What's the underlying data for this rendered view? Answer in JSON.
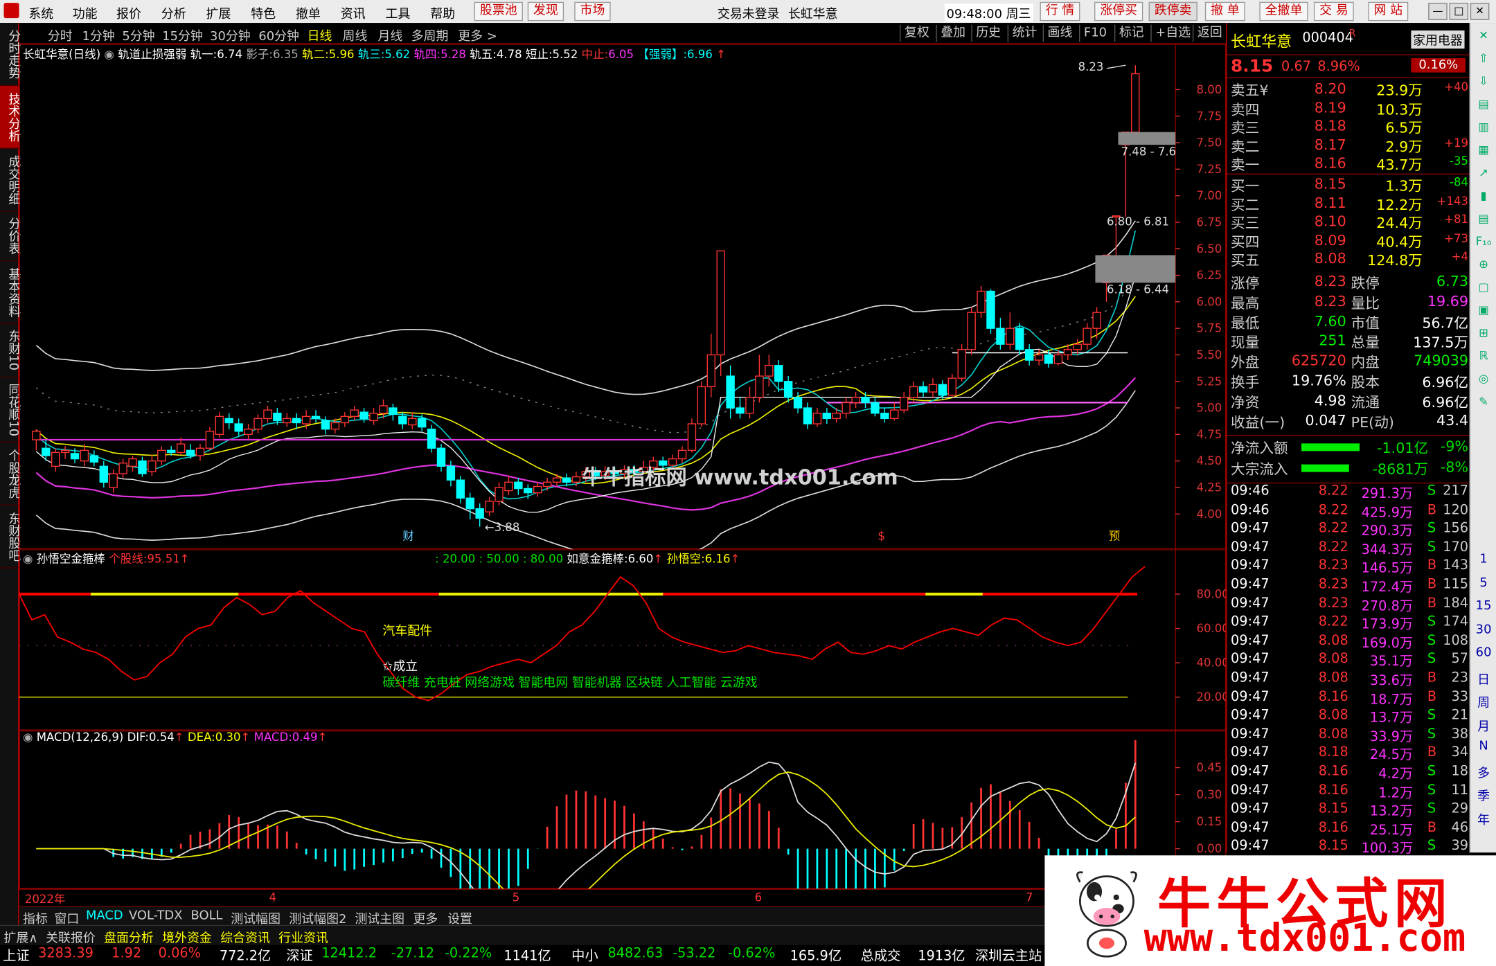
{
  "menu": {
    "items": [
      "系统",
      "功能",
      "报价",
      "分析",
      "扩展",
      "特色",
      "撤单",
      "资讯",
      "工具",
      "帮助"
    ],
    "tabs": [
      "股票池",
      "发现",
      "市场"
    ],
    "login_status": "交易未登录",
    "stock_name_title": "长虹华意",
    "time": "09:48:00 周三",
    "right_buttons": [
      "行 情",
      "涨停买",
      "跌停卖",
      "撤 单",
      "全撤单",
      "交 易",
      "网 站"
    ]
  },
  "left_tabs": [
    "分时走势",
    "技术分析",
    "成交明细",
    "分价表",
    "基本资料",
    "东财10",
    "同花顺10",
    "个股龙虎",
    "东财股吧"
  ],
  "periods": [
    "分时",
    "1分钟",
    "5分钟",
    "15分钟",
    "30分钟",
    "60分钟",
    "日线",
    "周线",
    "月线",
    "多周期",
    "更多 >"
  ],
  "toolbar": [
    "复权",
    "叠加",
    "历史",
    "统计",
    "画线",
    "F10",
    "标记",
    "+自选",
    "返回"
  ],
  "main_chart": {
    "legend": {
      "name": "长虹华意(日线)",
      "indicator": "轨道止损强弱",
      "t1_label": "轨一:",
      "t1": "6.74",
      "shadow_label": "影子:",
      "shadow": "6.35",
      "t2_label": "轨二:",
      "t2": "5.96",
      "t3_label": "轨三:",
      "t3": "5.62",
      "t4_label": "轨四:",
      "t4": "5.28",
      "t5_label": "轨五:",
      "t5": "4.78",
      "stop_label": "短止:",
      "stop": "5.52",
      "mid_label": "中止:",
      "mid": "6.05",
      "strong_label": "【强弱】:",
      "strong": "6.96"
    },
    "y_ticks": [
      "8.00",
      "7.75",
      "7.50",
      "7.25",
      "7.00",
      "6.75",
      "6.50",
      "6.25",
      "6.00",
      "5.75",
      "5.50",
      "5.25",
      "5.00",
      "4.75",
      "4.50",
      "4.25",
      "4.00"
    ],
    "annotations": {
      "high": "8.23",
      "low": "3.88",
      "range1": "7.48 - 7.6",
      "range2": "6.80 - 6.81",
      "range3": "6.18 - 6.44"
    },
    "markers": [
      "财",
      "$",
      "预"
    ],
    "watermark": "牛牛指标网 www.tdx001.com"
  },
  "sub1": {
    "legend_name": "孙悟空金箍棒",
    "legend_stock_label": "个股线:",
    "legend_stock": "95.51",
    "legend_levels": ": 20.00   : 50.00   : 80.00",
    "legend_ruyi_label": "如意金箍棒:",
    "legend_ruyi": "6.60",
    "legend_swk_label": "孙悟空:",
    "legend_swk": "6.16",
    "y_ticks": [
      "80.00",
      "60.00",
      "40.00",
      "20.00"
    ],
    "text1": "汽车配件",
    "text2": "✩成立",
    "text3": "碳纤维 充电桩 网络游戏 智能电网 智能机器 区块链 人工智能 云游戏"
  },
  "sub2": {
    "legend_name": "MACD(12,26,9)",
    "dif_label": "DIF:",
    "dif": "0.54",
    "dea_label": "DEA:",
    "dea": "0.30",
    "macd_label": "MACD:",
    "macd": "0.49",
    "y_ticks": [
      "0.45",
      "0.30",
      "0.15",
      "0.00"
    ]
  },
  "time_axis": [
    "2022年",
    "4",
    "5",
    "6",
    "7"
  ],
  "bottom_tabs": [
    "指标",
    "窗口",
    "MACD",
    "VOL-TDX",
    "BOLL",
    "测试幅图",
    "测试幅图2",
    "测试主图",
    "更多",
    "设置"
  ],
  "bottom_tabs2": [
    "扩展∧",
    "关联报价",
    "盘面分析",
    "境外资金",
    "综合资讯",
    "行业资讯"
  ],
  "quote": {
    "name": "长虹华意",
    "code": "000404",
    "mark": "R",
    "industry": "家用电器",
    "price": "8.15",
    "change": "0.67",
    "pct": "8.96%",
    "ind_pct": "0.16%",
    "asks": [
      {
        "label": "卖五¥",
        "price": "8.20",
        "vol": "23.9万",
        "chg": "+40"
      },
      {
        "label": "卖四",
        "price": "8.19",
        "vol": "10.3万",
        "chg": ""
      },
      {
        "label": "卖三",
        "price": "8.18",
        "vol": "6.5万",
        "chg": ""
      },
      {
        "label": "卖二",
        "price": "8.17",
        "vol": "2.9万",
        "chg": "+19"
      },
      {
        "label": "卖一",
        "price": "8.16",
        "vol": "43.7万",
        "chg": "-35"
      }
    ],
    "bids": [
      {
        "label": "买一",
        "price": "8.15",
        "vol": "1.3万",
        "chg": "-84"
      },
      {
        "label": "买二",
        "price": "8.11",
        "vol": "12.2万",
        "chg": "+143"
      },
      {
        "label": "买三",
        "price": "8.10",
        "vol": "24.4万",
        "chg": "+81"
      },
      {
        "label": "买四",
        "price": "8.09",
        "vol": "40.4万",
        "chg": "+73"
      },
      {
        "label": "买五",
        "price": "8.08",
        "vol": "124.8万",
        "chg": "+4"
      }
    ],
    "stats": [
      {
        "l1": "涨停",
        "v1": "8.23",
        "l2": "跌停",
        "v2": "6.73"
      },
      {
        "l1": "最高",
        "v1": "8.23",
        "l2": "量比",
        "v2": "19.69"
      },
      {
        "l1": "最低",
        "v1": "7.60",
        "l2": "市值",
        "v2": "56.7亿"
      },
      {
        "l1": "现量",
        "v1": "251",
        "l2": "总量",
        "v2": "137.5万"
      },
      {
        "l1": "外盘",
        "v1": "625720",
        "l2": "内盘",
        "v2": "749039"
      },
      {
        "l1": "换手",
        "v1": "19.76%",
        "l2": "股本",
        "v2": "6.96亿"
      },
      {
        "l1": "净资",
        "v1": "4.98",
        "l2": "流通",
        "v2": "6.96亿"
      },
      {
        "l1": "收益(一)",
        "v1": "0.047",
        "l2": "PE(动)",
        "v2": "43.4"
      }
    ],
    "flows": [
      {
        "label": "净流入额",
        "val": "-1.01亿",
        "pct": "-9%",
        "bar": 0.55
      },
      {
        "label": "大宗流入",
        "val": "-8681万",
        "pct": "-8%",
        "bar": 0.45
      }
    ],
    "ticks": [
      {
        "t": "09:46",
        "p": "8.22",
        "v": "291.3万",
        "s": "S",
        "n": "217"
      },
      {
        "t": "09:46",
        "p": "8.22",
        "v": "425.9万",
        "s": "B",
        "n": "120"
      },
      {
        "t": "09:47",
        "p": "8.22",
        "v": "290.3万",
        "s": "S",
        "n": "156"
      },
      {
        "t": "09:47",
        "p": "8.22",
        "v": "344.3万",
        "s": "S",
        "n": "170"
      },
      {
        "t": "09:47",
        "p": "8.23",
        "v": "146.5万",
        "s": "B",
        "n": "143"
      },
      {
        "t": "09:47",
        "p": "8.23",
        "v": "172.4万",
        "s": "B",
        "n": "115"
      },
      {
        "t": "09:47",
        "p": "8.23",
        "v": "270.8万",
        "s": "B",
        "n": "184"
      },
      {
        "t": "09:47",
        "p": "8.22",
        "v": "173.9万",
        "s": "S",
        "n": "174"
      },
      {
        "t": "09:47",
        "p": "8.08",
        "v": "169.0万",
        "s": "S",
        "n": "108"
      },
      {
        "t": "09:47",
        "p": "8.08",
        "v": "35.1万",
        "s": "S",
        "n": "57"
      },
      {
        "t": "09:47",
        "p": "8.08",
        "v": "33.6万",
        "s": "B",
        "n": "23"
      },
      {
        "t": "09:47",
        "p": "8.16",
        "v": "18.7万",
        "s": "B",
        "n": "33"
      },
      {
        "t": "09:47",
        "p": "8.08",
        "v": "13.7万",
        "s": "S",
        "n": "21"
      },
      {
        "t": "09:47",
        "p": "8.08",
        "v": "33.9万",
        "s": "S",
        "n": "38"
      },
      {
        "t": "09:47",
        "p": "8.18",
        "v": "24.5万",
        "s": "B",
        "n": "34"
      },
      {
        "t": "09:47",
        "p": "8.16",
        "v": "4.2万",
        "s": "S",
        "n": "18"
      },
      {
        "t": "09:47",
        "p": "8.16",
        "v": "1.2万",
        "s": "S",
        "n": "11"
      },
      {
        "t": "09:47",
        "p": "8.15",
        "v": "13.2万",
        "s": "S",
        "n": "29"
      },
      {
        "t": "09:47",
        "p": "8.16",
        "v": "25.1万",
        "s": "B",
        "n": "46"
      },
      {
        "t": "09:47",
        "p": "8.15",
        "v": "100.3万",
        "s": "S",
        "n": "39"
      }
    ]
  },
  "side_icons": [
    "1",
    "5",
    "15",
    "30",
    "60",
    "日",
    "周",
    "月",
    "N",
    "多",
    "季",
    "年"
  ],
  "status": {
    "sh_label": "上证",
    "sh": "3283.39",
    "sh_chg": "1.92",
    "sh_pct": "0.06%",
    "sh_amt": "772.2亿",
    "sz_label": "深证",
    "sz": "12412.2",
    "sz_chg": "-27.12",
    "sz_pct": "-0.22%",
    "sz_amt": "1141亿",
    "zx_label": "中小",
    "zx": "8482.63",
    "zx_chg": "-53.22",
    "zx_pct": "-0.62%",
    "zx_amt": "165.9亿",
    "total_label": "总成交",
    "total": "1913亿",
    "site": "深圳云主站"
  },
  "brand": {
    "title": "牛牛公式网",
    "url": "www.tdx001.com"
  },
  "colors": {
    "up": "#ff3333",
    "down": "#00ffff",
    "bg": "#000000",
    "accent": "#c00000"
  }
}
